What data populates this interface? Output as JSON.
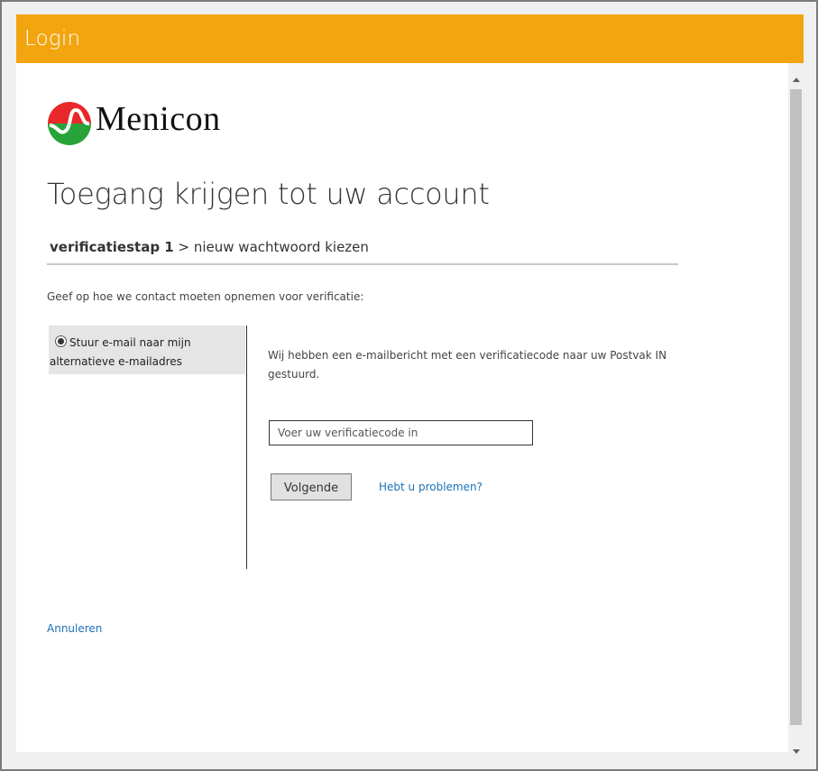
{
  "window": {
    "title": "Login"
  },
  "brand": {
    "logo_text": "Menicon",
    "colors": {
      "red": "#e8282a",
      "green": "#27a33a",
      "accent": "#f2a50f"
    }
  },
  "page": {
    "heading": "Toegang krijgen tot uw account",
    "steps": {
      "current": "verificatiestap 1",
      "next": "> nieuw wachtwoord kiezen"
    },
    "instruction": "Geef op hoe we contact moeten opnemen voor verificatie:"
  },
  "options": [
    {
      "line1": "Stuur e-mail naar mijn",
      "line2": "alternatieve e-mailadres",
      "selected": true
    }
  ],
  "verification": {
    "message": "Wij hebben een e-mailbericht met een verificatiecode naar uw Postvak IN gestuurd.",
    "code_placeholder": "Voer uw verificatiecode in",
    "code_value": "",
    "next_label": "Volgende",
    "help_label": "Hebt u problemen?"
  },
  "cancel_label": "Annuleren"
}
